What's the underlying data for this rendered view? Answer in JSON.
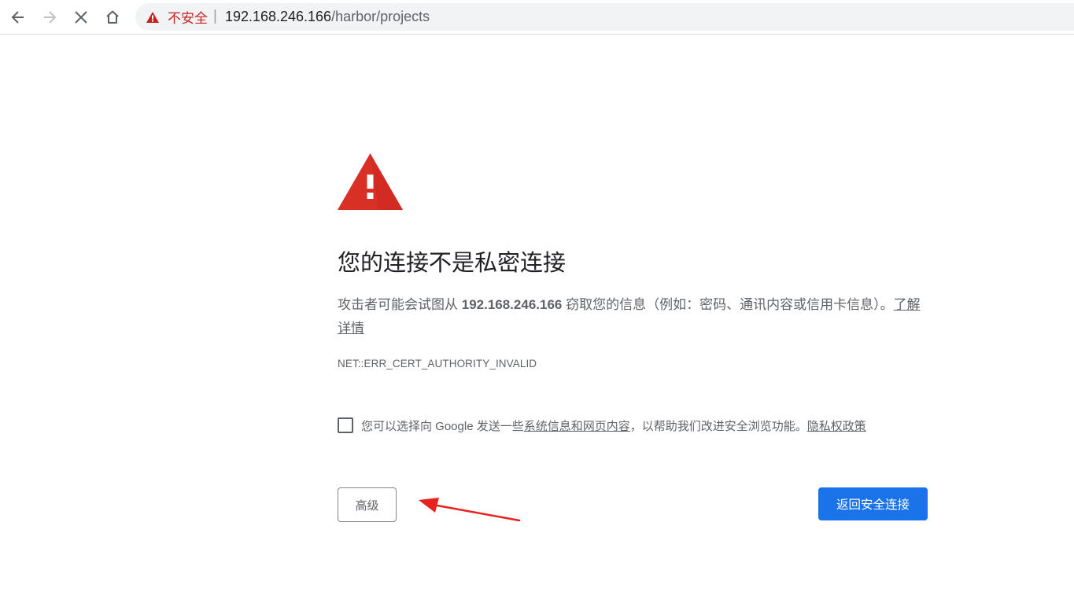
{
  "toolbar": {
    "back_icon": "arrow-left-icon",
    "forward_icon": "arrow-right-icon",
    "stop_icon": "close-icon",
    "home_icon": "home-icon",
    "omnibox": {
      "security_icon": "warning-triangle-icon",
      "security_label": "不安全",
      "separator": "|",
      "url_host": "192.168.246.166",
      "url_path": "/harbor/projects"
    }
  },
  "interstitial": {
    "icon": "warning-triangle-icon",
    "heading": "您的连接不是私密连接",
    "body_prefix": "攻击者可能会试图从 ",
    "host": "192.168.246.166",
    "body_suffix": " 窃取您的信息（例如：密码、通讯内容或信用卡信息）。",
    "learn_more": "了解详情",
    "error_code": "NET::ERR_CERT_AUTHORITY_INVALID",
    "optin": {
      "checked": false,
      "text_prefix": "您可以选择向 Google 发送一些",
      "link_system_info": "系统信息和网页内容",
      "text_middle": "，以帮助我们改进安全浏览功能。",
      "link_privacy": "隐私权政策"
    },
    "advanced_button": "高级",
    "back_to_safety_button": "返回安全连接"
  },
  "colors": {
    "danger": "#d93025",
    "link_blue": "#1a73e8",
    "annotation_arrow": "#e8231f",
    "text_secondary": "#5f6368",
    "text_primary": "#202124"
  }
}
